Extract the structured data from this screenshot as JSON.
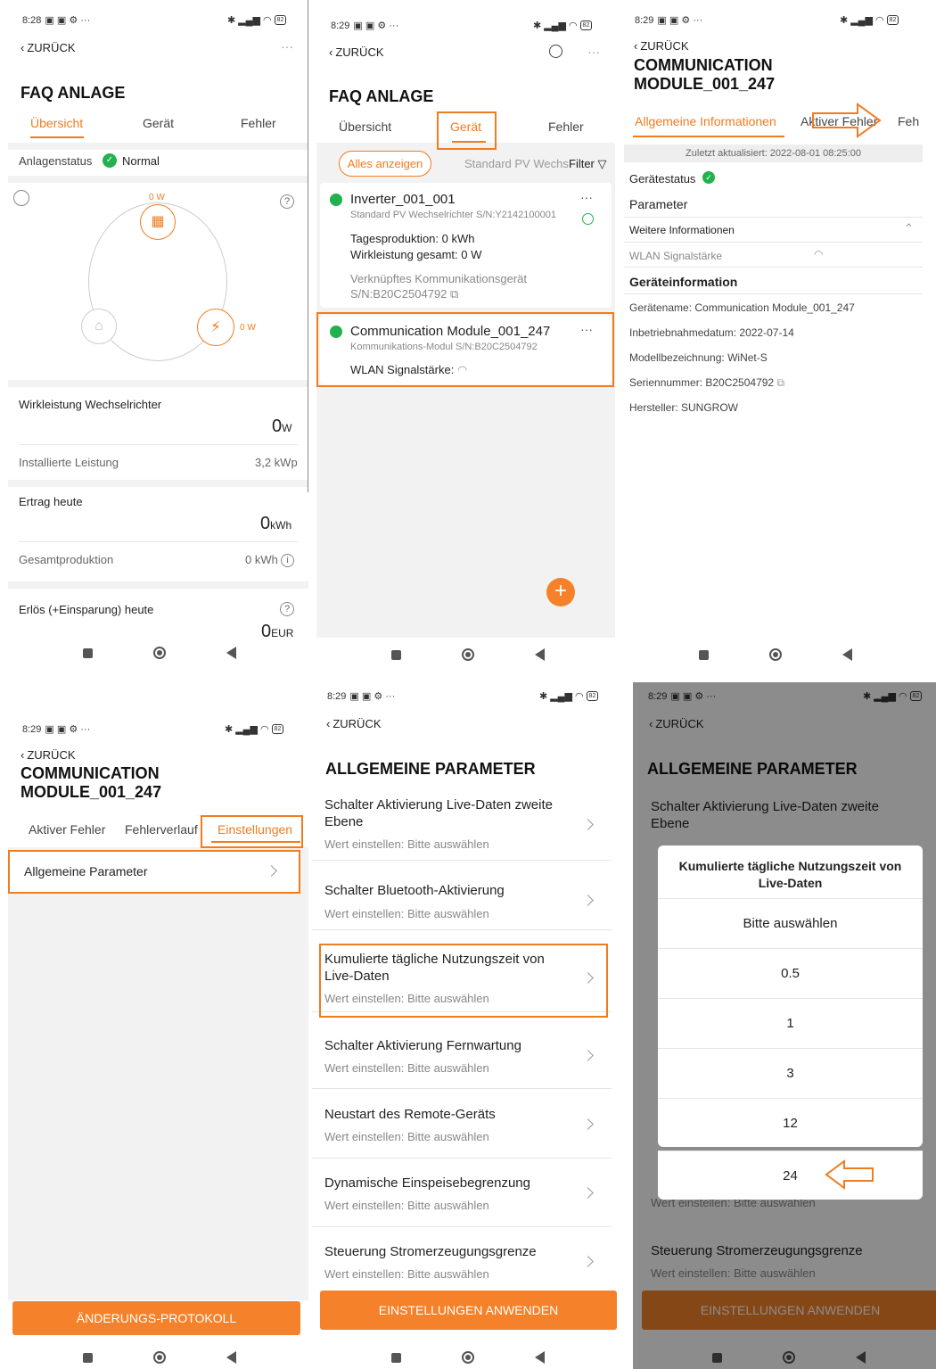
{
  "status": {
    "p1_time": "8:28",
    "p_time": "8:29",
    "icons": "▣ ▣ ⚙ ···",
    "battery": "82"
  },
  "common": {
    "back": "ZURÜCK",
    "faq_title": "FAQ ANLAGE",
    "tab_overview": "Übersicht",
    "tab_device": "Gerät",
    "tab_errors": "Fehler",
    "device_title_l1": "COMMUNICATION",
    "device_title_l2": "MODULE_001_247",
    "param_title": "ALLGEMEINE PARAMETER",
    "set_value": "Wert einstellen: Bitte auswählen",
    "apply_button": "EINSTELLUNGEN ANWENDEN"
  },
  "p1": {
    "status_label": "Anlagenstatus",
    "status_value": "Normal",
    "pv_power": "0 W",
    "grid_power": "0 W",
    "inv_label": "Wirkleistung Wechselrichter",
    "inv_value": "0",
    "inv_unit": "W",
    "installed_label": "Installierte Leistung",
    "installed_value": "3,2 kWp",
    "today_label": "Ertrag heute",
    "today_value": "0",
    "today_unit": "kWh",
    "total_label": "Gesamtproduktion",
    "total_value": "0 kWh",
    "revenue_label": "Erlös (+Einsparung) heute",
    "revenue_value": "0",
    "revenue_unit": "EUR"
  },
  "p2": {
    "show_all": "Alles anzeigen",
    "filter_type": "Standard PV Wechs",
    "filter": "Filter",
    "d1_name": "Inverter_001_001",
    "d1_sub": "Standard PV Wechselrichter S/N:Y2142100001",
    "d1_prod": "Tagesproduktion: 0 kWh",
    "d1_power": "Wirkleistung gesamt: 0 W",
    "d1_link": "Verknüpftes Kommunikationsgerät",
    "d1_link_sn": "S/N:B20C2504792",
    "d2_name": "Communication Module_001_247",
    "d2_sub": "Kommunikations-Modul S/N:B20C2504792",
    "d2_wlan": "WLAN Signalstärke:"
  },
  "p3": {
    "tab_general": "Allgemeine Informationen",
    "tab_active": "Aktiver Fehler",
    "tab_more": "Feh",
    "updated": "Zuletzt aktualisiert: 2022-08-01 08:25:00",
    "status": "Gerätestatus",
    "params": "Parameter",
    "more_info": "Weitere Informationen",
    "wlan": "WLAN Signalstärke",
    "dev_info": "Geräteinformation",
    "name": "Gerätename: Communication Module_001_247",
    "commission": "Inbetriebnahmedatum: 2022-07-14",
    "model": "Modellbezeichnung: WiNet-S",
    "serial": "Seriennummer: B20C2504792",
    "maker": "Hersteller: SUNGROW"
  },
  "p4": {
    "tab_active": "Aktiver Fehler",
    "tab_history": "Fehlerverlauf",
    "tab_settings": "Einstellungen",
    "general": "Allgemeine Parameter",
    "changelog": "ÄNDERUNGS-PROTOKOLL"
  },
  "p5": {
    "r1a": "Schalter Aktivierung Live-Daten zweite",
    "r1b": "Ebene",
    "r2": "Schalter Bluetooth-Aktivierung",
    "r3a": "Kumulierte tägliche Nutzungszeit von",
    "r3b": "Live-Daten",
    "r4": "Schalter Aktivierung Fernwartung",
    "r5": "Neustart des Remote-Geräts",
    "r6": "Dynamische Einspeisebegrenzung",
    "r7": "Steuerung Stromerzeugungsgrenze"
  },
  "p6": {
    "dlg_title_l1": "Kumulierte tägliche Nutzungszeit von",
    "dlg_title_l2": "Live-Daten",
    "opt0": "Bitte auswählen",
    "opt1": "0.5",
    "opt2": "1",
    "opt3": "3",
    "opt4": "12",
    "opt5": "24"
  }
}
